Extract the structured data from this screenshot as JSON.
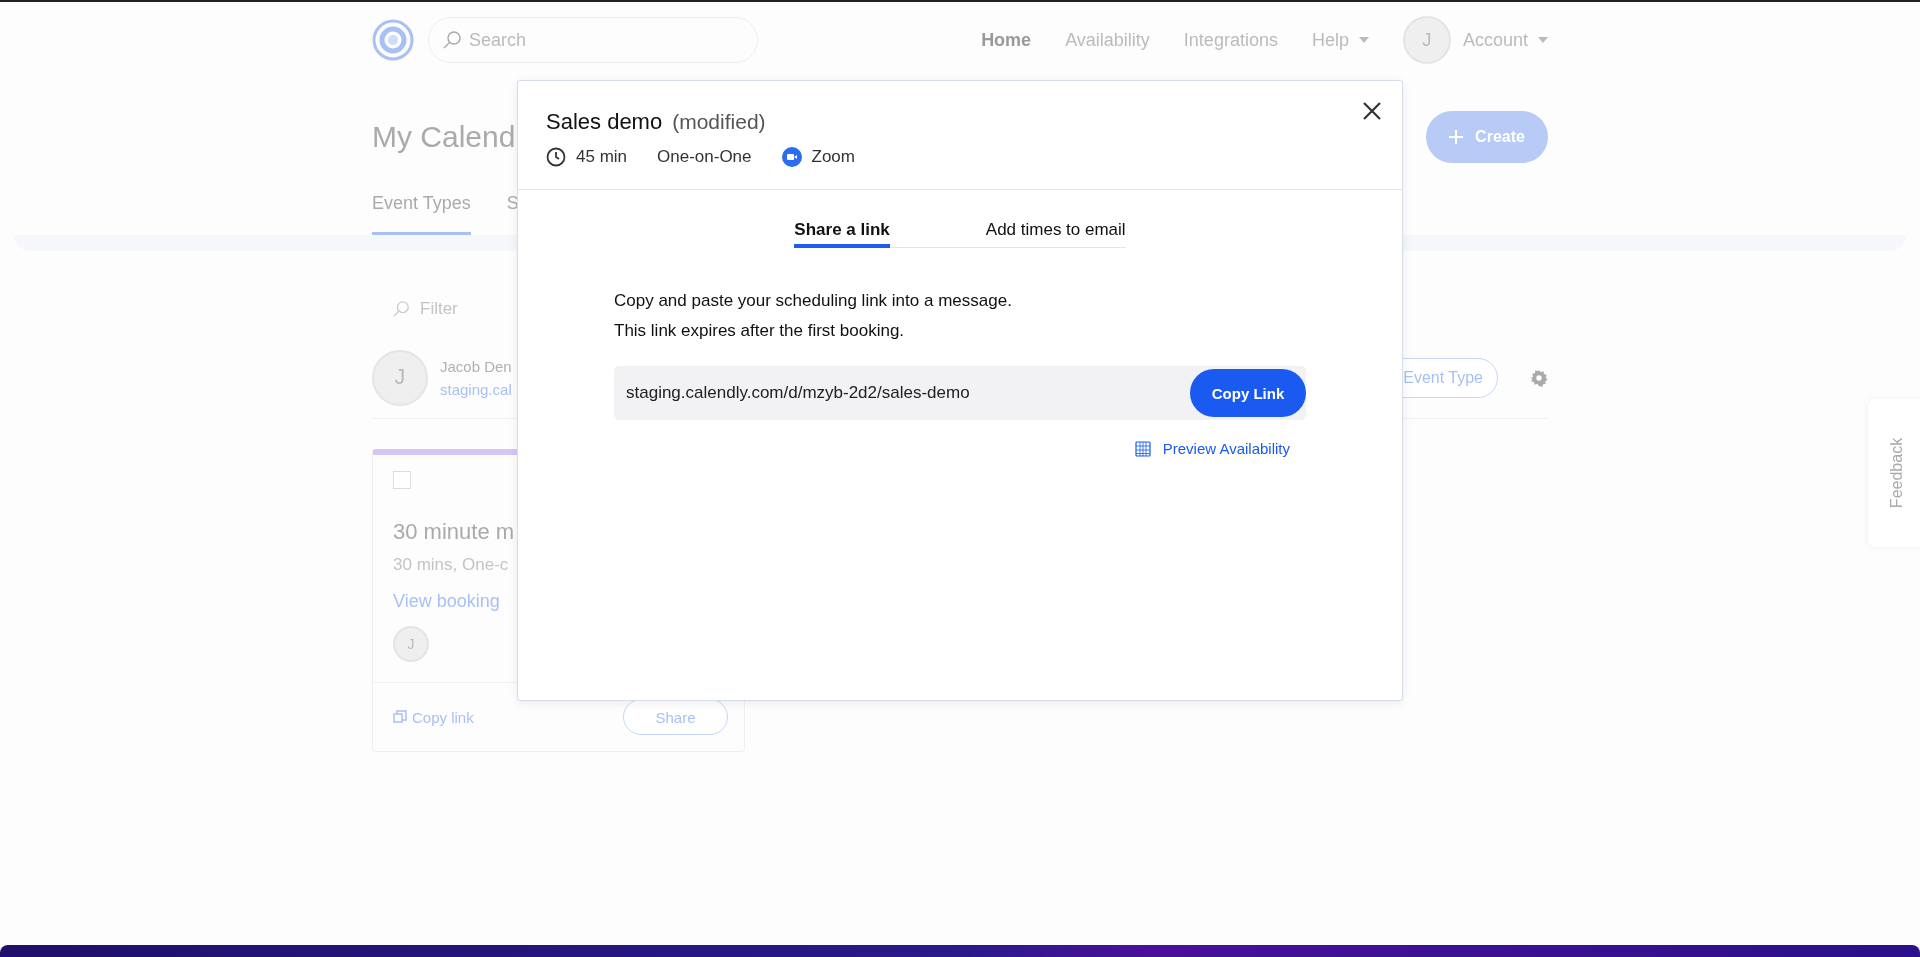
{
  "nav": {
    "search": {
      "placeholder": "Search"
    },
    "items": [
      {
        "label": "Home",
        "selected": true
      },
      {
        "label": "Availability",
        "selected": false
      },
      {
        "label": "Integrations",
        "selected": false
      }
    ],
    "help": "Help",
    "account": {
      "initial": "J",
      "label": "Account"
    }
  },
  "page": {
    "title": "My Calend",
    "tabs": [
      {
        "label": "Event Types",
        "selected": true
      },
      {
        "label": "S",
        "selected": false
      }
    ],
    "create_button": "Create",
    "filter": {
      "placeholder": "Filter"
    },
    "user": {
      "initial": "J",
      "name": "Jacob Den",
      "link": "staging.cal"
    },
    "event_type_button": "Event Type",
    "card": {
      "checked": false,
      "title": "30 minute m",
      "subtitle": "30 mins, One-c",
      "link": "View booking",
      "initial": "J",
      "copy_link": "Copy link",
      "share": "Share"
    }
  },
  "modal": {
    "title": "Sales demo",
    "status": "(modified)",
    "meta": {
      "duration": "45 min",
      "type": "One-on-One",
      "location": "Zoom"
    },
    "tabs": [
      {
        "label": "Share a link",
        "selected": true
      },
      {
        "label": "Add times to email",
        "selected": false
      }
    ],
    "description": [
      "Copy and paste your scheduling link into a message.",
      "This link expires after the first booking."
    ],
    "link": "staging.calendly.com/d/mzyb-2d2/sales-demo",
    "copy_button": "Copy Link",
    "preview": "Preview Availability"
  },
  "feedback": "Feedback"
}
